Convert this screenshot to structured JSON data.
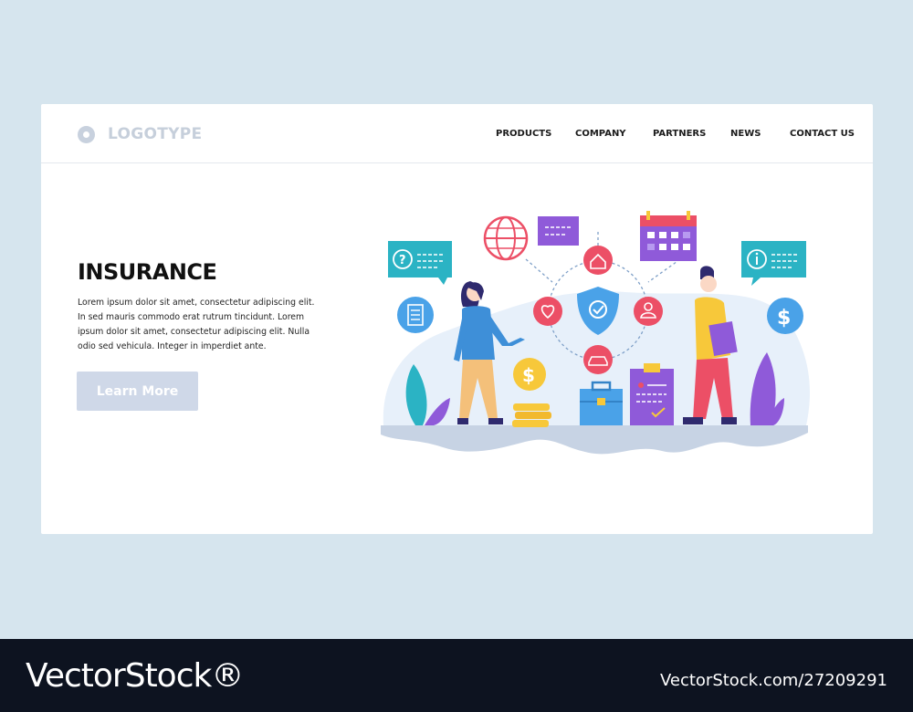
{
  "brand": {
    "logo_text": "LOGOTYPE"
  },
  "nav": {
    "items": [
      {
        "label": "PRODUCTS"
      },
      {
        "label": "COMPANY"
      },
      {
        "label": "PARTNERS"
      },
      {
        "label": "NEWS"
      },
      {
        "label": "CONTACT US"
      }
    ]
  },
  "hero": {
    "title": "INSURANCE",
    "description": "Lorem ipsum dolor sit amet, consectetur adipiscing elit. In sed mauris commodo erat rutrum tincidunt. Lorem ipsum dolor sit amet, consectetur adipiscing elit. Nulla  odio sed vehicula. Integer in imperdiet ante.",
    "cta_label": "Learn More"
  },
  "illustration": {
    "icons": [
      "globe-icon",
      "calendar-icon",
      "help-chat-icon",
      "info-chat-icon",
      "document-icon",
      "dollar-icon",
      "home-icon",
      "heart-icon",
      "shield-check-icon",
      "user-icon",
      "car-icon",
      "coin-icon",
      "briefcase-icon",
      "clipboard-icon"
    ],
    "colors": {
      "purple": "#8f5ad9",
      "red": "#ec4f66",
      "blue": "#4aa2e8",
      "teal": "#2bb3c4",
      "yellow": "#f7c83a"
    }
  },
  "watermark": {
    "left": "VectorStock®",
    "right": "VectorStock.com/27209291"
  }
}
